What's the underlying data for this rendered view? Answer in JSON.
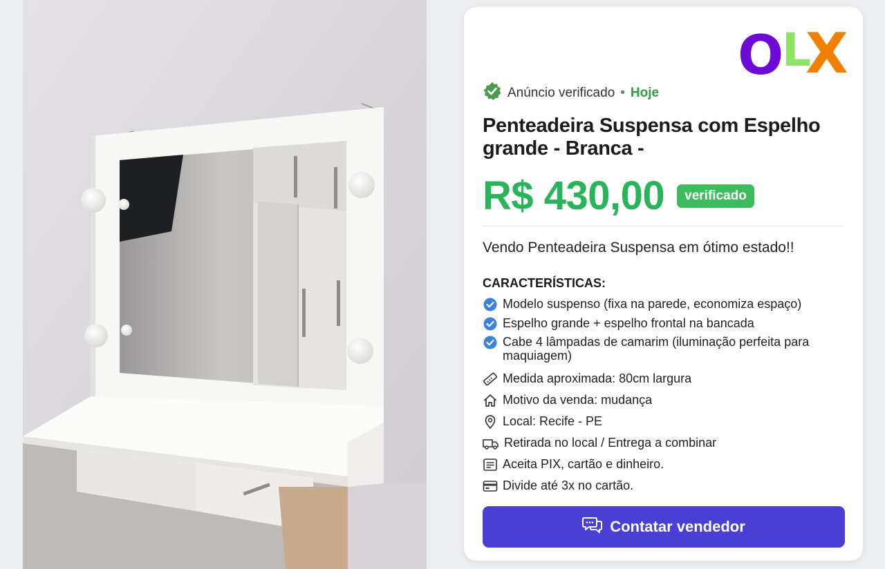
{
  "photo": {
    "alt": "Penteadeira suspensa branca com espelho e lâmpadas"
  },
  "brand": {
    "o": "O",
    "l": "L",
    "x": "X",
    "colors": {
      "o": "#6e0ad6",
      "l": "#8ce563",
      "x": "#f28000"
    }
  },
  "listing": {
    "verified_label": "Anúncio verificado",
    "separator": "•",
    "date": "Hoje",
    "title": "Penteadeira Suspensa com Espelho grande - Branca -",
    "price": "R$ 430,00",
    "price_badge": "verificado",
    "lead": "Vendo Penteadeira Suspensa em ótimo estado!!",
    "features_title": "CARACTERÍSTICAS:",
    "features": [
      {
        "icon": "check-circle-icon",
        "text": "Modelo suspenso (fixa na parede, economiza espaço)"
      },
      {
        "icon": "check-circle-icon",
        "text": "Espelho grande + espelho frontal na bancada"
      },
      {
        "icon": "check-circle-icon",
        "text": "Cabe 4 lâmpadas de camarim (iluminação perfeita para maquiagem)"
      },
      {
        "icon": "ruler-icon",
        "text": "Medida aproximada: 80cm largura"
      },
      {
        "icon": "home-icon",
        "text": "Motivo da venda: mudança"
      },
      {
        "icon": "location-pin-icon",
        "text": "Local: Recife - PE"
      },
      {
        "icon": "truck-icon",
        "text": "Retirada no local / Entrega a combinar"
      },
      {
        "icon": "receipt-icon",
        "text": "Aceita PIX, cartão e dinheiro."
      },
      {
        "icon": "credit-card-icon",
        "text": "Divide até 3x no cartão."
      }
    ],
    "cta_label": "Contatar vendedor"
  },
  "colors": {
    "price": "#29b35a",
    "badge": "#3dbc5e",
    "cta": "#4a3fd4",
    "check": "#3a83d6",
    "verified": "#4a9b4a"
  }
}
